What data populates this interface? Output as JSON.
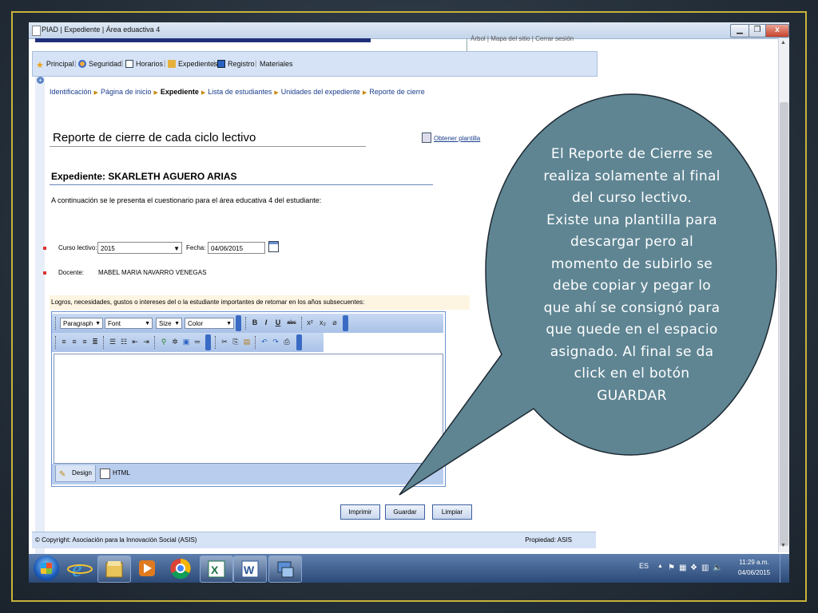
{
  "window": {
    "title": "PIAD | Expediente | Área eduactiva 4",
    "min": "▁",
    "max": "❐",
    "close": "x",
    "topright": "Árbol | Mapa del sitio | Cerrar sesión"
  },
  "menu": [
    {
      "label": "Principal",
      "icon": "star-icon"
    },
    {
      "label": "Seguridad",
      "icon": "users-icon"
    },
    {
      "label": "Horarios",
      "icon": "calendar-icon"
    },
    {
      "label": "Expedientes",
      "icon": "folder-icon"
    },
    {
      "label": "Registro",
      "icon": "register-icon"
    },
    {
      "label": "Materiales",
      "icon": ""
    }
  ],
  "breadcrumb": [
    "Identificación",
    "Página de inicio",
    "Expediente",
    "Lista de estudiantes",
    "Unidades del expediente",
    "Reporte de cierre"
  ],
  "page": {
    "title": "Reporte de cierre de cada ciclo lectivo",
    "template_link": "Obtener plantilla",
    "expediente": "Expediente: SKARLETH AGUERO ARIAS",
    "intro": "A continuación se le presenta el cuestionario para el área educativa 4 del estudiante:"
  },
  "form": {
    "curso_label": "Curso lectivo:",
    "curso_value": "2015",
    "fecha_label": "Fecha:",
    "fecha_value": "04/06/2015",
    "docente_label": "Docente:",
    "docente_value": "MABEL MARIA NAVARRO VENEGAS",
    "notes_label": "Logros, necesidades, gustos o intereses del o la estudiante importantes de retomar en los años subsecuentes:"
  },
  "editor": {
    "paragraph": "Paragraph",
    "font": "Font",
    "size": "Size",
    "color": "Color",
    "bold": "B",
    "italic": "I",
    "underline": "U",
    "strike": "abc",
    "superscript": "x²",
    "subscript": "x₂",
    "tab_design": "Design",
    "tab_html": "HTML"
  },
  "buttons": {
    "print": "Imprimir",
    "save": "Guardar",
    "clear": "Limpiar"
  },
  "footer": {
    "copyright": "© Copyright: Asociación para la Innovación Social (ASIS)",
    "owner": "Propiedad: ASIS"
  },
  "taskbar": {
    "lang": "ES",
    "time": "11:29 a.m.",
    "date": "04/06/2015"
  },
  "callout": {
    "lines": [
      "El Reporte de Cierre se",
      "realiza solamente al final",
      "del curso lectivo.",
      "Existe una plantilla para",
      "descargar pero  al",
      "momento de subirlo se",
      "debe copiar y pegar lo",
      "que ahí se consignó para",
      "que quede en el espacio",
      "asignado. Al final se da",
      "click en el botón",
      "GUARDAR"
    ],
    "fill": "#5f8593"
  }
}
